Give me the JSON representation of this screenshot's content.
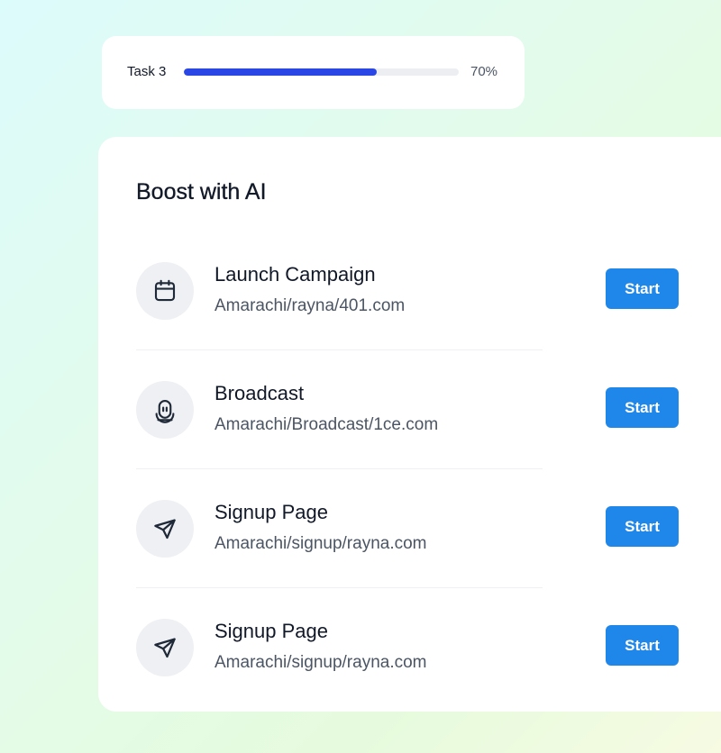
{
  "task": {
    "label": "Task 3",
    "progress": 0.7,
    "percent_text": "70%"
  },
  "card": {
    "title": "Boost with AI",
    "items": [
      {
        "icon": "calendar-icon",
        "title": "Launch Campaign",
        "subtitle": "Amarachi/rayna/401.com",
        "button": "Start"
      },
      {
        "icon": "broadcast-icon",
        "title": "Broadcast",
        "subtitle": "Amarachi/Broadcast/1ce.com",
        "button": "Start"
      },
      {
        "icon": "send-icon",
        "title": "Signup Page",
        "subtitle": "Amarachi/signup/rayna.com",
        "button": "Start"
      },
      {
        "icon": "send-icon",
        "title": "Signup Page",
        "subtitle": "Amarachi/signup/rayna.com",
        "button": "Start"
      }
    ]
  },
  "colors": {
    "accent": "#1f86ea",
    "progress": "#2a47e6",
    "text": "#111827",
    "muted": "#4b5563"
  }
}
